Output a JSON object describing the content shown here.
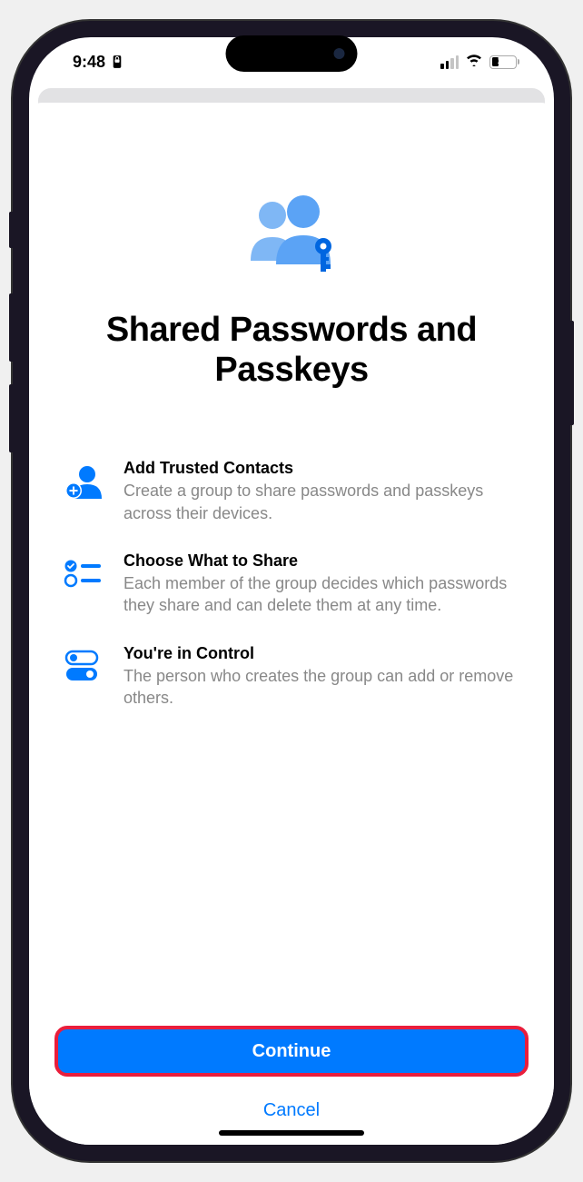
{
  "status_bar": {
    "time": "9:48",
    "battery_percent": "30"
  },
  "modal": {
    "title": "Shared Passwords and Passkeys",
    "features": [
      {
        "title": "Add Trusted Contacts",
        "description": "Create a group to share passwords and passkeys across their devices."
      },
      {
        "title": "Choose What to Share",
        "description": "Each member of the group decides which passwords they share and can delete them at any time."
      },
      {
        "title": "You're in Control",
        "description": "The person who creates the group can add or remove others."
      }
    ],
    "primary_button": "Continue",
    "secondary_button": "Cancel"
  }
}
